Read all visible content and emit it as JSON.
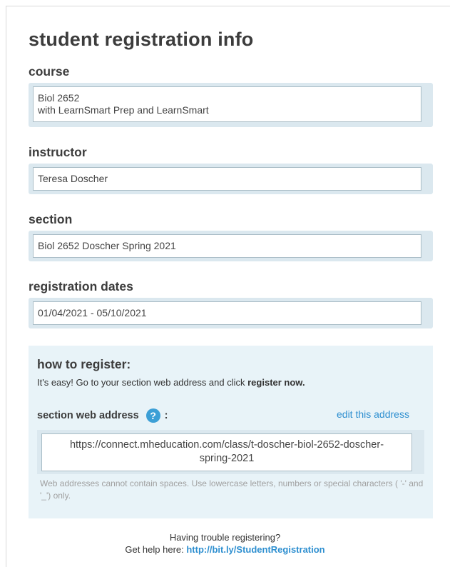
{
  "title": "student registration info",
  "course": {
    "label": "course",
    "line1": "Biol 2652",
    "line2": "with LearnSmart Prep and LearnSmart"
  },
  "instructor": {
    "label": "instructor",
    "value": "Teresa Doscher"
  },
  "section": {
    "label": "section",
    "value": "Biol 2652 Doscher Spring 2021"
  },
  "registration_dates": {
    "label": "registration dates",
    "value": "01/04/2021 - 05/10/2021"
  },
  "how_to_register": {
    "title": "how to register:",
    "text_prefix": "It's easy! Go to your section web address and click ",
    "text_bold": "register now.",
    "web_address_label": "section web address",
    "help_icon_glyph": "?",
    "label_colon": ":",
    "edit_link": "edit this address",
    "url_line1": "https://connect.mheducation.com/class/t-doscher-biol-2652-doscher-",
    "url_line2": "spring-2021",
    "note": "Web addresses cannot contain spaces. Use lowercase letters, numbers or special characters ( '-' and '_') only."
  },
  "footer": {
    "line1": "Having trouble registering?",
    "line2_prefix": "Get help here: ",
    "help_link": "http://bit.ly/StudentRegistration"
  },
  "colors": {
    "accent": "#2e8fd0",
    "field_bg": "#dbe8ef",
    "panel_bg": "#e8f3f8",
    "help_icon": "#3c9fd6"
  }
}
